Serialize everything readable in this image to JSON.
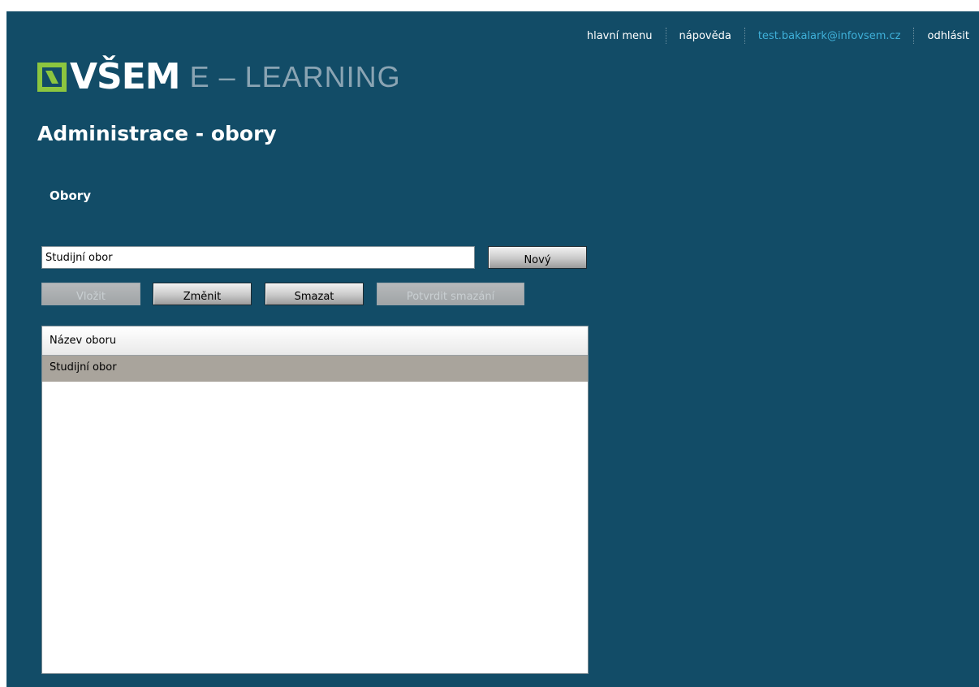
{
  "topnav": {
    "main_menu": "hlavní menu",
    "help": "nápověda",
    "user_email": "test.bakalark@infovsem.cz",
    "logout": "odhlásit"
  },
  "logo": {
    "brand": "VŠEM",
    "subtitle": "E – LEARNING"
  },
  "page": {
    "title": "Administrace - obory",
    "section_title": "Obory"
  },
  "form": {
    "field_value": "Studijní obor",
    "new_label": "Nový",
    "insert_label": "Vložit",
    "change_label": "Změnit",
    "delete_label": "Smazat",
    "confirm_delete_label": "Potvrdit smazání"
  },
  "list": {
    "header": "Název oboru",
    "rows": [
      {
        "name": "Studijní obor",
        "selected": true
      }
    ]
  },
  "colors": {
    "panel_background": "#124c67",
    "logo_accent": "#8cc63f",
    "email_link": "#3fb0d9",
    "selected_row": "#a9a49c"
  }
}
